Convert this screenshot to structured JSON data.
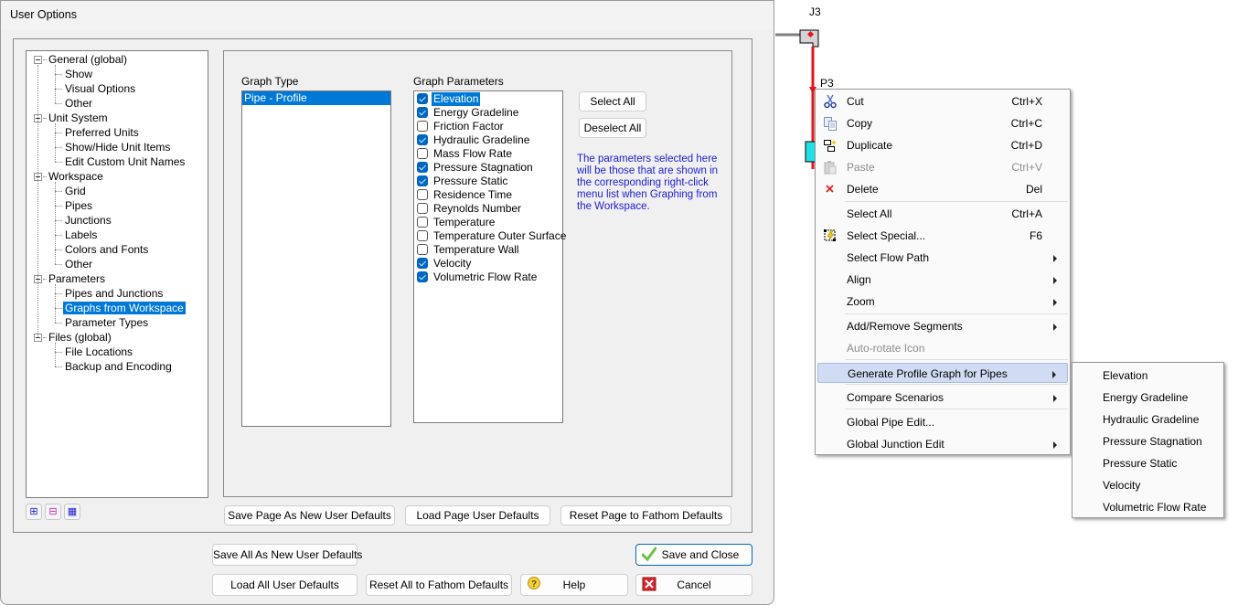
{
  "dialog": {
    "title": "User Options",
    "tree": [
      {
        "label": "General (global)",
        "level": 0
      },
      {
        "label": "Show",
        "level": 1
      },
      {
        "label": "Visual Options",
        "level": 1
      },
      {
        "label": "Other",
        "level": 1
      },
      {
        "label": "Unit System",
        "level": 0
      },
      {
        "label": "Preferred Units",
        "level": 1
      },
      {
        "label": "Show/Hide Unit Items",
        "level": 1
      },
      {
        "label": "Edit Custom Unit Names",
        "level": 1
      },
      {
        "label": "Workspace",
        "level": 0
      },
      {
        "label": "Grid",
        "level": 1
      },
      {
        "label": "Pipes",
        "level": 1
      },
      {
        "label": "Junctions",
        "level": 1
      },
      {
        "label": "Labels",
        "level": 1
      },
      {
        "label": "Colors and Fonts",
        "level": 1
      },
      {
        "label": "Other",
        "level": 1
      },
      {
        "label": "Parameters",
        "level": 0
      },
      {
        "label": "Pipes and Junctions",
        "level": 1
      },
      {
        "label": "Graphs from Workspace",
        "level": 1,
        "selected": true
      },
      {
        "label": "Parameter Types",
        "level": 1
      },
      {
        "label": "Files (global)",
        "level": 0
      },
      {
        "label": "File Locations",
        "level": 1
      },
      {
        "label": "Backup and Encoding",
        "level": 1
      }
    ],
    "tree_tools": [
      {
        "name": "expand-all-icon",
        "glyph": "⊞"
      },
      {
        "name": "expand-selected-icon",
        "glyph": "⊟"
      },
      {
        "name": "collapse-all-icon",
        "glyph": "▦"
      }
    ],
    "graph_type": {
      "label": "Graph Type",
      "items": [
        {
          "label": "Pipe - Profile",
          "selected": true
        }
      ]
    },
    "graph_parameters": {
      "label": "Graph Parameters",
      "items": [
        {
          "label": "Elevation",
          "checked": true,
          "selected": true
        },
        {
          "label": "Energy Gradeline",
          "checked": true
        },
        {
          "label": "Friction Factor",
          "checked": false
        },
        {
          "label": "Hydraulic Gradeline",
          "checked": true
        },
        {
          "label": "Mass Flow Rate",
          "checked": false
        },
        {
          "label": "Pressure Stagnation",
          "checked": true
        },
        {
          "label": "Pressure Static",
          "checked": true
        },
        {
          "label": "Residence Time",
          "checked": false
        },
        {
          "label": "Reynolds Number",
          "checked": false
        },
        {
          "label": "Temperature",
          "checked": false
        },
        {
          "label": "Temperature Outer Surface",
          "checked": false
        },
        {
          "label": "Temperature Wall",
          "checked": false
        },
        {
          "label": "Velocity",
          "checked": true
        },
        {
          "label": "Volumetric Flow Rate",
          "checked": true
        }
      ]
    },
    "select_all": "Select All",
    "deselect_all": "Deselect All",
    "note": "The parameters selected here will be those that are shown in the corresponding right-click menu list when Graphing from the Workspace.",
    "page_buttons": {
      "save_page": "Save Page As New User Defaults",
      "load_page": "Load Page User Defaults",
      "reset_page": "Reset Page to Fathom Defaults"
    },
    "footer_buttons": {
      "save_all": "Save All As New User Defaults",
      "load_all": "Load All User Defaults",
      "reset_all": "Reset All to Fathom Defaults",
      "help": "Help",
      "save_close": "Save and Close",
      "cancel": "Cancel"
    }
  },
  "workspace": {
    "junction_label": "J3",
    "pipe_label": "P3",
    "pipe_color": "#e8131a",
    "tank_color": "#22e0e8"
  },
  "context_menu": {
    "items": [
      {
        "label": "Cut",
        "shortcut": "Ctrl+X",
        "icon": "scissors-icon"
      },
      {
        "label": "Copy",
        "shortcut": "Ctrl+C",
        "icon": "copy-icon"
      },
      {
        "label": "Duplicate",
        "shortcut": "Ctrl+D",
        "icon": "duplicate-icon"
      },
      {
        "label": "Paste",
        "shortcut": "Ctrl+V",
        "icon": "paste-icon",
        "disabled": true
      },
      {
        "label": "Delete",
        "shortcut": "Del",
        "icon": "delete-icon"
      },
      {
        "label": "Select All",
        "shortcut": "Ctrl+A"
      },
      {
        "label": "Select Special...",
        "shortcut": "F6",
        "icon": "select-special-icon"
      },
      {
        "label": "Select Flow Path",
        "submenu": true
      },
      {
        "label": "Align",
        "submenu": true
      },
      {
        "label": "Zoom",
        "submenu": true
      },
      {
        "label": "Add/Remove Segments",
        "submenu": true
      },
      {
        "label": "Auto-rotate Icon",
        "disabled": true
      },
      {
        "label": "Generate Profile Graph for Pipes",
        "submenu": true,
        "hover": true
      },
      {
        "label": "Compare Scenarios",
        "submenu": true
      },
      {
        "label": "Global Pipe Edit..."
      },
      {
        "label": "Global Junction Edit",
        "submenu": true
      }
    ],
    "submenu_items": [
      "Elevation",
      "Energy Gradeline",
      "Hydraulic Gradeline",
      "Pressure Stagnation",
      "Pressure Static",
      "Velocity",
      "Volumetric Flow Rate"
    ]
  }
}
